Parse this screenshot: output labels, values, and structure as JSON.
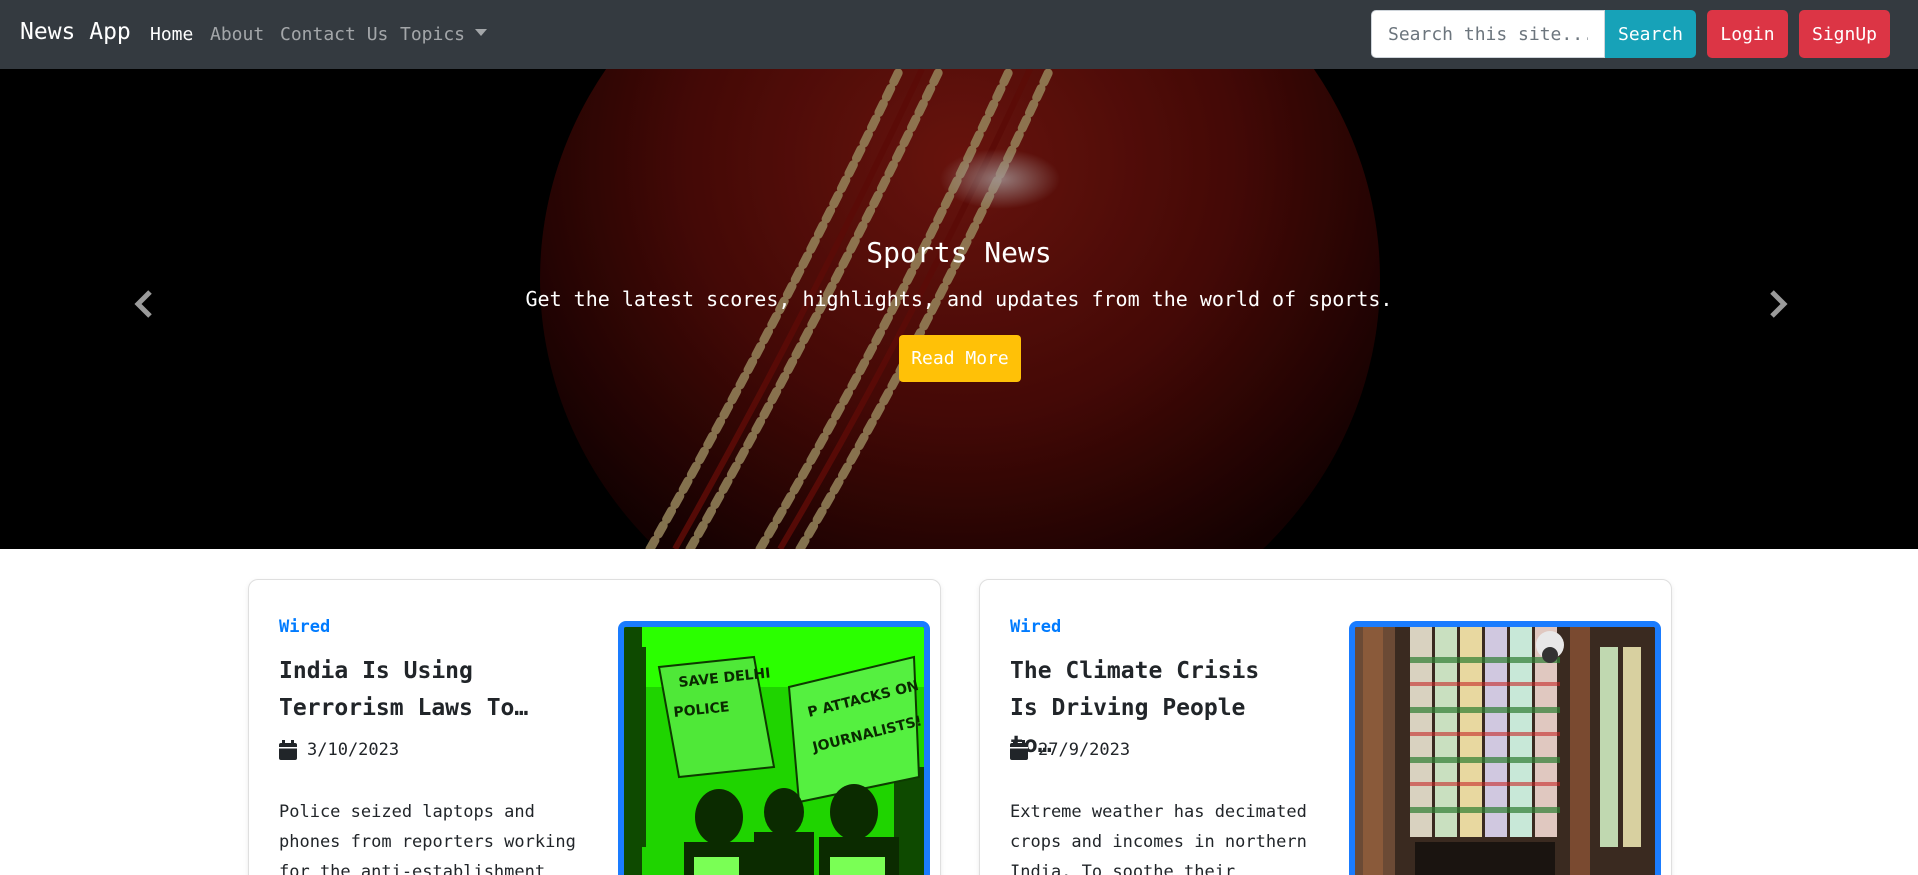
{
  "navbar": {
    "brand": "News App",
    "links": [
      {
        "label": "Home",
        "active": true
      },
      {
        "label": "About"
      },
      {
        "label": "Contact Us"
      },
      {
        "label": "Topics",
        "dropdown": true
      }
    ],
    "search": {
      "placeholder": "Search this site...",
      "value": ""
    },
    "search_button": "Search",
    "login_button": "Login",
    "signup_button": "SignUp"
  },
  "hero": {
    "title": "Sports News",
    "text": "Get the latest scores, highlights, and updates from the world of sports.",
    "button": "Read More",
    "prev_icon": "chevron-left-icon",
    "next_icon": "chevron-right-icon"
  },
  "articles": [
    {
      "source": "Wired",
      "title": "India Is Using Terrorism Laws To…",
      "date": "3/10/2023",
      "description": "Police seized laptops and phones from reporters working for the anti-establishment",
      "image_alt": "Protest with placards reading attacks on journalists"
    },
    {
      "source": "Wired",
      "title": "The Climate Crisis Is Driving People to…",
      "date": "27/9/2023",
      "description": "Extreme weather has decimated crops and incomes in northern India. To soothe their",
      "image_alt": "Shop stall hung with lottery tickets"
    }
  ],
  "colors": {
    "navbar_bg": "#343a40",
    "search_button": "#17a2b8",
    "danger": "#dc3545",
    "warning": "#ffc107",
    "primary": "#007bff",
    "thumb_border": "#1a7cff"
  }
}
